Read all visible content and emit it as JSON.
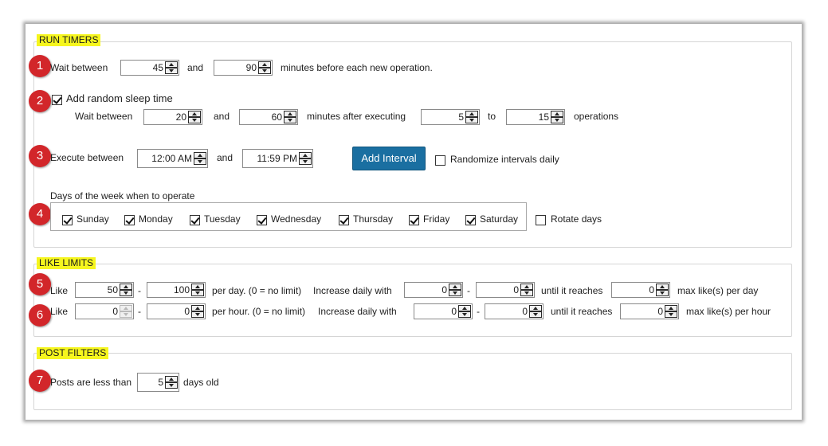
{
  "run_timers": {
    "legend": "RUN TIMERS",
    "row1": {
      "marker": "1",
      "label": "Wait between",
      "min": "45",
      "and": "and",
      "max": "90",
      "suffix": "minutes before each new operation."
    },
    "row2": {
      "marker": "2",
      "random_sleep_label": "Add random sleep time",
      "random_sleep_checked": true,
      "wait_label": "Wait between",
      "min": "20",
      "and": "and",
      "max": "60",
      "after_label": "minutes after executing",
      "ops_min": "5",
      "to": "to",
      "ops_max": "15",
      "ops_label": "operations"
    },
    "row3": {
      "marker": "3",
      "label": "Execute between",
      "start": "12:00 AM",
      "and": "and",
      "end": "11:59 PM",
      "add_interval": "Add Interval",
      "randomize_label": "Randomize intervals daily",
      "randomize_checked": false
    },
    "days": {
      "marker": "4",
      "title": "Days of the week when to operate",
      "items": [
        {
          "label": "Sunday",
          "checked": true
        },
        {
          "label": "Monday",
          "checked": true
        },
        {
          "label": "Tuesday",
          "checked": true
        },
        {
          "label": "Wednesday",
          "checked": true
        },
        {
          "label": "Thursday",
          "checked": true
        },
        {
          "label": "Friday",
          "checked": true
        },
        {
          "label": "Saturday",
          "checked": true
        }
      ],
      "rotate_label": "Rotate days",
      "rotate_checked": false
    }
  },
  "like_limits": {
    "legend": "LIKE LIMITS",
    "per_day": {
      "marker": "5",
      "label": "Like",
      "min": "50",
      "dash": "-",
      "max": "100",
      "per_text": "per day. (0 = no limit)",
      "increase_label": "Increase daily with",
      "inc_min": "0",
      "dash2": "-",
      "inc_max": "0",
      "until_label": "until it reaches",
      "reach": "0",
      "max_label": "max like(s) per day"
    },
    "per_hour": {
      "marker": "6",
      "label": "Like",
      "min": "0",
      "dash": "-",
      "max": "0",
      "per_text": "per hour. (0 = no limit)",
      "increase_label": "Increase daily with",
      "inc_min": "0",
      "dash2": "-",
      "inc_max": "0",
      "until_label": "until it reaches",
      "reach": "0",
      "max_label": "max like(s) per hour"
    }
  },
  "post_filters": {
    "legend": "POST FILTERS",
    "row": {
      "marker": "7",
      "label": "Posts are less than",
      "value": "5",
      "suffix": "days old"
    }
  }
}
